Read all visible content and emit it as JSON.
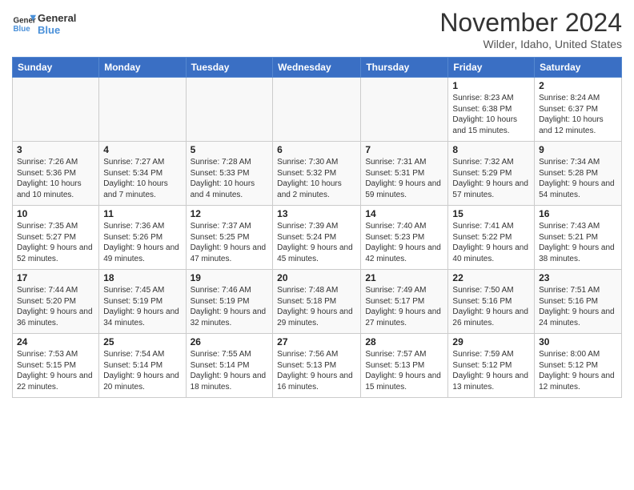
{
  "logo": {
    "line1": "General",
    "line2": "Blue"
  },
  "title": "November 2024",
  "location": "Wilder, Idaho, United States",
  "days_of_week": [
    "Sunday",
    "Monday",
    "Tuesday",
    "Wednesday",
    "Thursday",
    "Friday",
    "Saturday"
  ],
  "weeks": [
    [
      {
        "num": "",
        "info": ""
      },
      {
        "num": "",
        "info": ""
      },
      {
        "num": "",
        "info": ""
      },
      {
        "num": "",
        "info": ""
      },
      {
        "num": "",
        "info": ""
      },
      {
        "num": "1",
        "info": "Sunrise: 8:23 AM\nSunset: 6:38 PM\nDaylight: 10 hours and 15 minutes."
      },
      {
        "num": "2",
        "info": "Sunrise: 8:24 AM\nSunset: 6:37 PM\nDaylight: 10 hours and 12 minutes."
      }
    ],
    [
      {
        "num": "3",
        "info": "Sunrise: 7:26 AM\nSunset: 5:36 PM\nDaylight: 10 hours and 10 minutes."
      },
      {
        "num": "4",
        "info": "Sunrise: 7:27 AM\nSunset: 5:34 PM\nDaylight: 10 hours and 7 minutes."
      },
      {
        "num": "5",
        "info": "Sunrise: 7:28 AM\nSunset: 5:33 PM\nDaylight: 10 hours and 4 minutes."
      },
      {
        "num": "6",
        "info": "Sunrise: 7:30 AM\nSunset: 5:32 PM\nDaylight: 10 hours and 2 minutes."
      },
      {
        "num": "7",
        "info": "Sunrise: 7:31 AM\nSunset: 5:31 PM\nDaylight: 9 hours and 59 minutes."
      },
      {
        "num": "8",
        "info": "Sunrise: 7:32 AM\nSunset: 5:29 PM\nDaylight: 9 hours and 57 minutes."
      },
      {
        "num": "9",
        "info": "Sunrise: 7:34 AM\nSunset: 5:28 PM\nDaylight: 9 hours and 54 minutes."
      }
    ],
    [
      {
        "num": "10",
        "info": "Sunrise: 7:35 AM\nSunset: 5:27 PM\nDaylight: 9 hours and 52 minutes."
      },
      {
        "num": "11",
        "info": "Sunrise: 7:36 AM\nSunset: 5:26 PM\nDaylight: 9 hours and 49 minutes."
      },
      {
        "num": "12",
        "info": "Sunrise: 7:37 AM\nSunset: 5:25 PM\nDaylight: 9 hours and 47 minutes."
      },
      {
        "num": "13",
        "info": "Sunrise: 7:39 AM\nSunset: 5:24 PM\nDaylight: 9 hours and 45 minutes."
      },
      {
        "num": "14",
        "info": "Sunrise: 7:40 AM\nSunset: 5:23 PM\nDaylight: 9 hours and 42 minutes."
      },
      {
        "num": "15",
        "info": "Sunrise: 7:41 AM\nSunset: 5:22 PM\nDaylight: 9 hours and 40 minutes."
      },
      {
        "num": "16",
        "info": "Sunrise: 7:43 AM\nSunset: 5:21 PM\nDaylight: 9 hours and 38 minutes."
      }
    ],
    [
      {
        "num": "17",
        "info": "Sunrise: 7:44 AM\nSunset: 5:20 PM\nDaylight: 9 hours and 36 minutes."
      },
      {
        "num": "18",
        "info": "Sunrise: 7:45 AM\nSunset: 5:19 PM\nDaylight: 9 hours and 34 minutes."
      },
      {
        "num": "19",
        "info": "Sunrise: 7:46 AM\nSunset: 5:19 PM\nDaylight: 9 hours and 32 minutes."
      },
      {
        "num": "20",
        "info": "Sunrise: 7:48 AM\nSunset: 5:18 PM\nDaylight: 9 hours and 29 minutes."
      },
      {
        "num": "21",
        "info": "Sunrise: 7:49 AM\nSunset: 5:17 PM\nDaylight: 9 hours and 27 minutes."
      },
      {
        "num": "22",
        "info": "Sunrise: 7:50 AM\nSunset: 5:16 PM\nDaylight: 9 hours and 26 minutes."
      },
      {
        "num": "23",
        "info": "Sunrise: 7:51 AM\nSunset: 5:16 PM\nDaylight: 9 hours and 24 minutes."
      }
    ],
    [
      {
        "num": "24",
        "info": "Sunrise: 7:53 AM\nSunset: 5:15 PM\nDaylight: 9 hours and 22 minutes."
      },
      {
        "num": "25",
        "info": "Sunrise: 7:54 AM\nSunset: 5:14 PM\nDaylight: 9 hours and 20 minutes."
      },
      {
        "num": "26",
        "info": "Sunrise: 7:55 AM\nSunset: 5:14 PM\nDaylight: 9 hours and 18 minutes."
      },
      {
        "num": "27",
        "info": "Sunrise: 7:56 AM\nSunset: 5:13 PM\nDaylight: 9 hours and 16 minutes."
      },
      {
        "num": "28",
        "info": "Sunrise: 7:57 AM\nSunset: 5:13 PM\nDaylight: 9 hours and 15 minutes."
      },
      {
        "num": "29",
        "info": "Sunrise: 7:59 AM\nSunset: 5:12 PM\nDaylight: 9 hours and 13 minutes."
      },
      {
        "num": "30",
        "info": "Sunrise: 8:00 AM\nSunset: 5:12 PM\nDaylight: 9 hours and 12 minutes."
      }
    ]
  ]
}
